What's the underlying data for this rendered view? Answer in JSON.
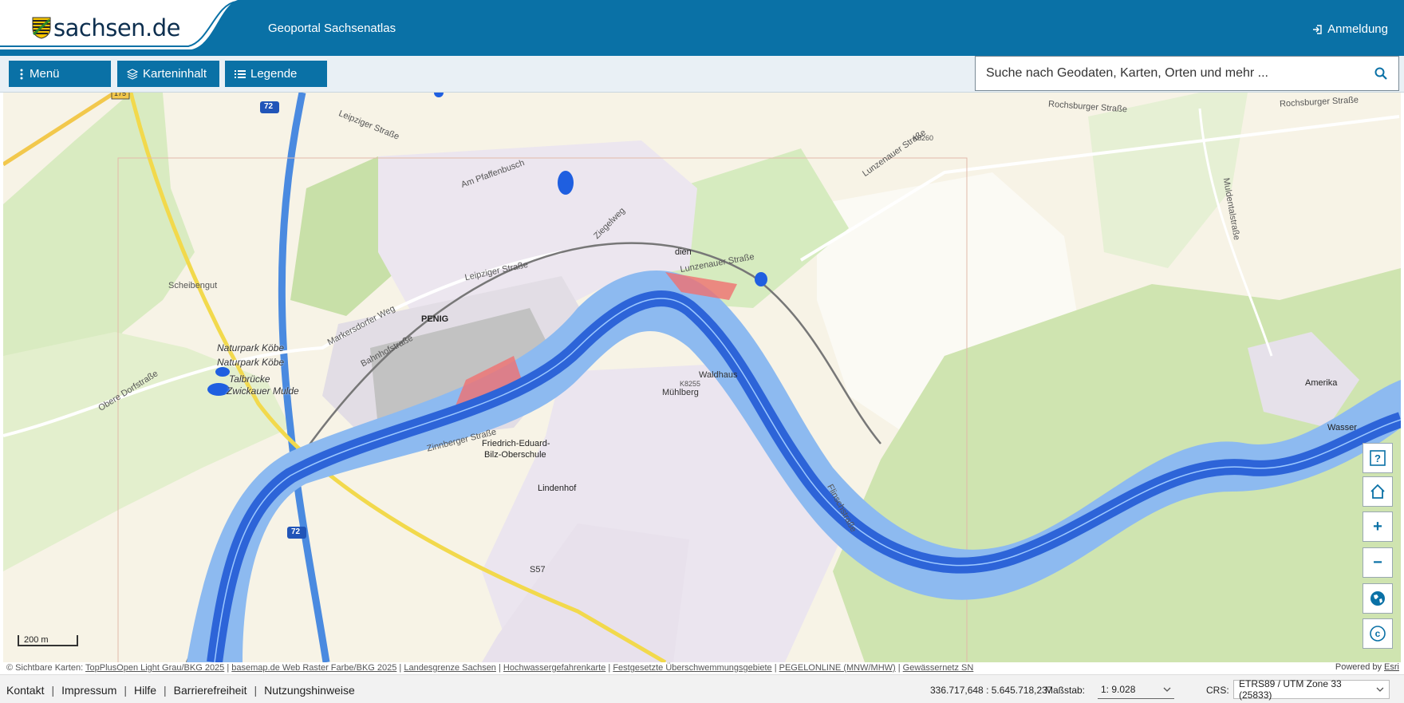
{
  "header": {
    "logo_text": "sachsen.de",
    "portal_title": "Geoportal Sachsenatlas",
    "login_label": "Anmeldung"
  },
  "toolbar": {
    "menu_label": "Menü",
    "content_label": "Karteninhalt",
    "legend_label": "Legende"
  },
  "search": {
    "placeholder": "Suche nach Geodaten, Karten, Orten und mehr ..."
  },
  "map": {
    "labels": {
      "penig": "PENIG",
      "scheibengut": "Scheibengut",
      "naturpark1": "Naturpark Köbe",
      "naturpark2": "Naturpark Köbe",
      "talbruecke1": "Talbrücke",
      "talbruecke2": "Zwickauer Mulde",
      "amerika": "Amerika",
      "friedrich1": "Friedrich-Eduard-",
      "friedrich2": "Bilz-Oberschule",
      "lindenhof": "Lindenhof",
      "muehlberg": "Mühlberg",
      "waldhaus": "Waldhaus",
      "leipziger_str": "Leipziger Straße",
      "leipziger_str2": "Leipziger Straße",
      "markersdorfer_weg": "Markersdorfer Weg",
      "bahnhofstrasse": "Bahnhofstraße",
      "obere_dorfstrasse": "Obere Dorfstraße",
      "zinnberger_str": "Zinnberger Straße",
      "lunzenauer_str": "Lunzenauer Straße",
      "lunzenauer_str2": "Lunzenauer Straße",
      "rochsburger_str": "Rochsburger Straße",
      "rochsburger_str2": "Rochsburger Straße",
      "am_pfaffenbusch": "Am Pfaffenbusch",
      "muldentalstrasse": "Muldentalstraße",
      "flinschstrasse": "Flinschstraße",
      "ziegelweg": "Ziegelweg",
      "k8260": "K8260",
      "k8255": "K8255",
      "a72_top": "72",
      "a72_bottom": "72",
      "b175": "175",
      "s57": "S57",
      "dien": "dien",
      "wasser": "Wasser"
    },
    "scale_bar": "200 m"
  },
  "map_controls": {
    "help": "?",
    "zoom_in": "+",
    "zoom_out": "−",
    "copyright": "©"
  },
  "attribution": {
    "prefix": "© Sichtbare Karten:",
    "items": [
      "TopPlusOpen Light Grau/BKG 2025",
      "basemap.de Web Raster Farbe/BKG 2025",
      "Landesgrenze Sachsen",
      "Hochwassergefahrenkarte",
      "Festgesetzte Überschwemmungsgebiete",
      "PEGELONLINE (MNW/MHW)",
      "Gewässernetz SN"
    ],
    "powered_prefix": "Powered by",
    "powered_link": "Esri"
  },
  "footer": {
    "links": [
      "Kontakt",
      "Impressum",
      "Hilfe",
      "Barrierefreiheit",
      "Nutzungshinweise"
    ],
    "coordinates": "336.717,648 : 5.645.718,237",
    "scale_label": "Maßstab:",
    "scale_value": "1: 9.028",
    "crs_label": "CRS:",
    "crs_value": "ETRS89 / UTM Zone 33 (25833)"
  },
  "colors": {
    "brand_blue": "#0a71a6",
    "flood_dark": "#2d64d8",
    "flood_light": "#86b4f0",
    "flood_red": "#f07070"
  }
}
